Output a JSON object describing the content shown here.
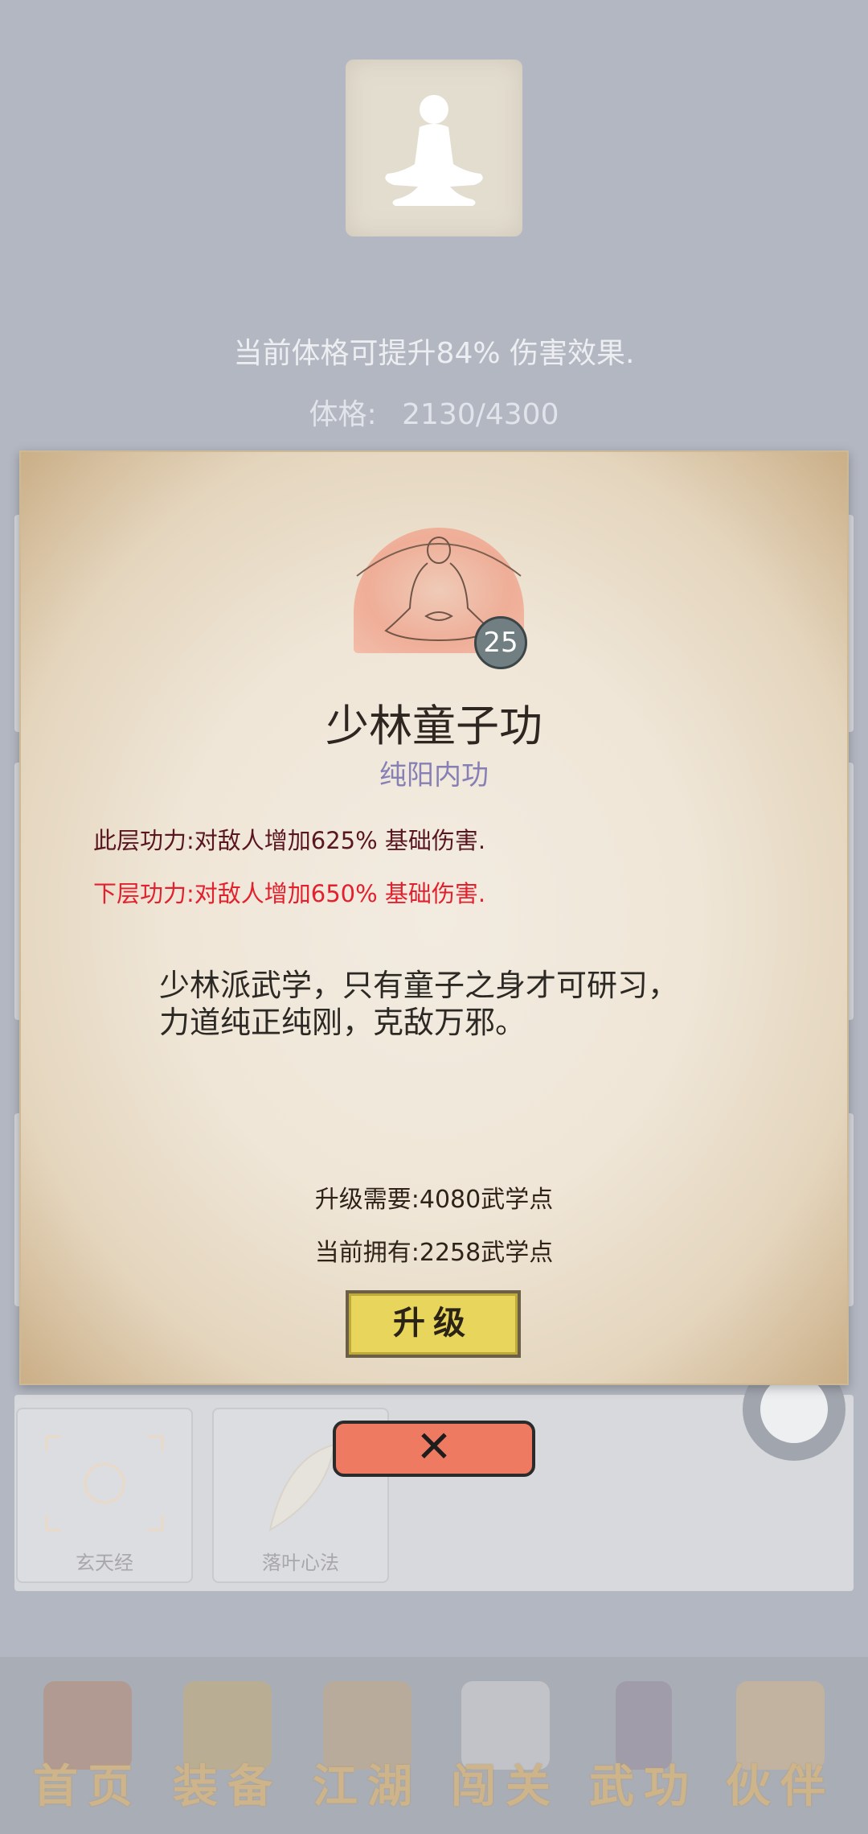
{
  "header": {
    "bonus_text": "当前体格可提升84% 伤害效果.",
    "stat_label": "体格:",
    "stat_value": "2130/4300"
  },
  "dialog": {
    "level": "25",
    "skill_name": "少林童子功",
    "skill_type": "纯阳内功",
    "current_effect": "此层功力:对敌人增加625% 基础伤害.",
    "next_effect": "下层功力:对敌人增加650% 基础伤害.",
    "description_line1": "少林派武学，只有童子之身才可研习，",
    "description_line2": "力道纯正纯刚，克敌万邪。",
    "requirement": "升级需要:4080武学点",
    "owned": "当前拥有:2258武学点",
    "upgrade_label": "升级",
    "close_label": "✕"
  },
  "skill_list": [
    {
      "name": "玄天经"
    },
    {
      "name": "落叶心法"
    }
  ],
  "nav": [
    {
      "label": "首页",
      "icon": "temple-icon"
    },
    {
      "label": "装备",
      "icon": "armor-icon"
    },
    {
      "label": "江湖",
      "icon": "scroll-map-icon"
    },
    {
      "label": "闯关",
      "icon": "crossed-swords-icon"
    },
    {
      "label": "武功",
      "icon": "martial-book-icon"
    },
    {
      "label": "伙伴",
      "icon": "companions-icon"
    }
  ],
  "colors": {
    "damage_next": "#e3202d",
    "damage_current": "#5a1620",
    "skill_type": "#8680b4",
    "upgrade_button": "#e8d65c",
    "close_button": "#ef7a62"
  }
}
